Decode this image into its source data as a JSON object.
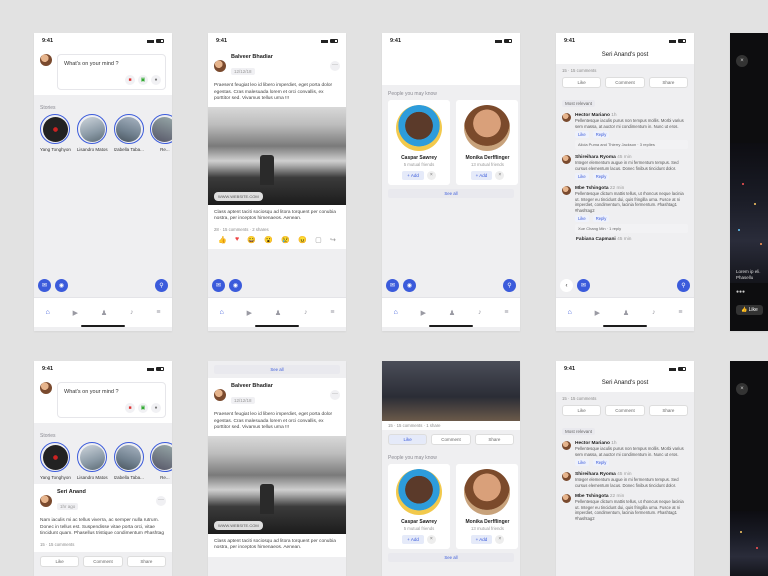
{
  "status_time": "9:41",
  "feed": {
    "mind_prompt": "What's on your mind ?",
    "stories_title": "Stories",
    "stories": [
      "Yang Tonghyon",
      "Lisandro Matos",
      "Izabella Taba...",
      "Re..."
    ],
    "post_author": "Seri Anand",
    "post_time": "1hr ago",
    "post_text": "Nam iaculis mi ac tellus viverra, ac semper nulla rutrum. Donec in tellus est. Suspendisse vitae porta orci, vitae tincidunt quam. Phasellus tristique condimentum #hashtag",
    "post_meta": "15 · 15 comments",
    "like": "Like",
    "comment": "Comment",
    "share": "Share"
  },
  "post": {
    "author": "Balveer Bhadiar",
    "date": "12/12/18",
    "text": "Praesent feugiat leo id libero imperdiet, eget porta dolor egestas. Cras malesuada lorem et orci convallis, ex porttitor sed. Vivamus tellus urna !!!",
    "link": "WWW.WEBSITE.COM",
    "caption": "Class aptent taciti sociosqu ad litora torquent per conubia nostra, per inceptos himenaeos. Aenean.",
    "meta": "28 · 15 comments · 2 shares",
    "see_all": "See all"
  },
  "pymk": {
    "title": "People you may know",
    "people": [
      {
        "name": "Caspar Sawrey",
        "mutual": "5 mutual friends"
      },
      {
        "name": "Monika Derfflinger",
        "mutual": "13 mutual friends"
      }
    ],
    "add": "Add",
    "see_all": "See all",
    "top_meta": "15 · 15 comments · 1 share"
  },
  "comments_screen": {
    "title": "Seri Anand's post",
    "meta": "15 · 15 comments",
    "like": "Like",
    "comment": "Comment",
    "share": "Share",
    "sort": "Most relevant",
    "comments": [
      {
        "name": "Hector Mariano",
        "time": "1h",
        "text": "Pellentesque iaculis purus non tempus mollis. Morbi varius sem massa, at auctor mi condimentum in. Nunc ut eros.",
        "reply_line": "Alicia Puma and Thierry Jackson · 3 replies"
      },
      {
        "name": "Shireihara Ryoma",
        "time": "45 min",
        "text": "Integer elementum augue in mi fermentum tempus. Sed cursus elementum lacus. Donec finibus tincidunt dolor.",
        "reply_line": ""
      },
      {
        "name": "Mbe Tshingota",
        "time": "22 min",
        "text": "Pellentesque dictum mattis tellus, ut rhoncus neque lacinia ut. Integer eu tincidunt dui, quis fringilla urna. Fusce at ni imperdiet, condimentum, lacinia fermentum. #hashtag1 #hashtag2",
        "reply_line": "Xue Chang Min · 1 reply"
      }
    ],
    "last_name": "Fabiana Capmani",
    "last_time": "45 min",
    "like_btn": "Like",
    "reply_btn": "Reply"
  },
  "dark": {
    "caption": "Lorem ip eli. Phasellu",
    "like": "Like"
  }
}
